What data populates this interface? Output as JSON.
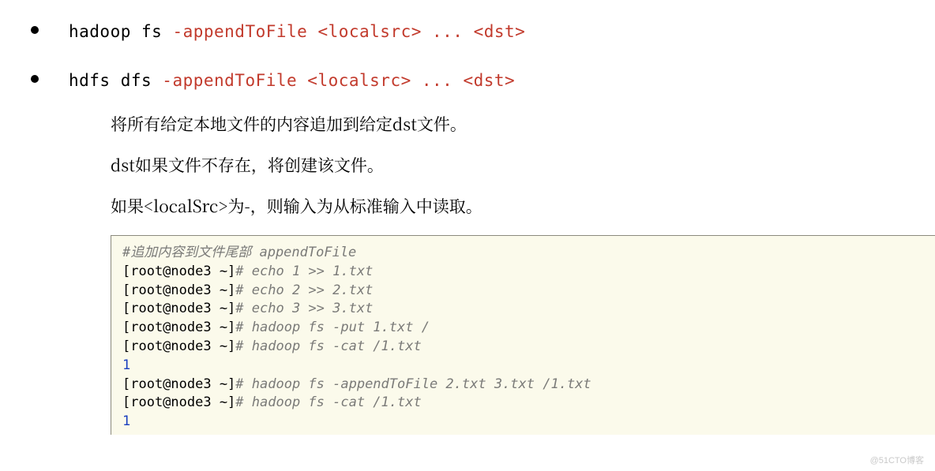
{
  "bullets": [
    {
      "prefix": "hadoop fs ",
      "hl": "-appendToFile <localsrc> ... <dst>"
    },
    {
      "prefix": "hdfs dfs ",
      "hl": "-appendToFile <localsrc> ... <dst>"
    }
  ],
  "desc": {
    "p1": "将所有给定本地文件的内容追加到给定dst文件。",
    "p2": "dst如果文件不存在，将创建该文件。",
    "p3": "如果<localSrc>为-，则输入为从标准输入中读取。"
  },
  "terminal": {
    "comment_header": "#追加内容到文件尾部 appendToFile",
    "lines": [
      {
        "prompt": "[root@node3 ~]",
        "hash": "#",
        "cmd": " echo 1 >> 1.txt"
      },
      {
        "prompt": "[root@node3 ~]",
        "hash": "#",
        "cmd": " echo 2 >> 2.txt"
      },
      {
        "prompt": "[root@node3 ~]",
        "hash": "#",
        "cmd": " echo 3 >> 3.txt"
      },
      {
        "prompt": "[root@node3 ~]",
        "hash": "#",
        "cmd": " hadoop fs -put 1.txt /"
      },
      {
        "prompt": "[root@node3 ~]",
        "hash": "#",
        "cmd": " hadoop fs -cat /1.txt"
      }
    ],
    "out1": "1",
    "lines2": [
      {
        "prompt": "[root@node3 ~]",
        "hash": "#",
        "cmd": " hadoop fs -appendToFile 2.txt 3.txt /1.txt"
      },
      {
        "prompt": "[root@node3 ~]",
        "hash": "#",
        "cmd": " hadoop fs -cat /1.txt"
      }
    ],
    "out2": "1"
  },
  "watermark": "@51CTO博客"
}
